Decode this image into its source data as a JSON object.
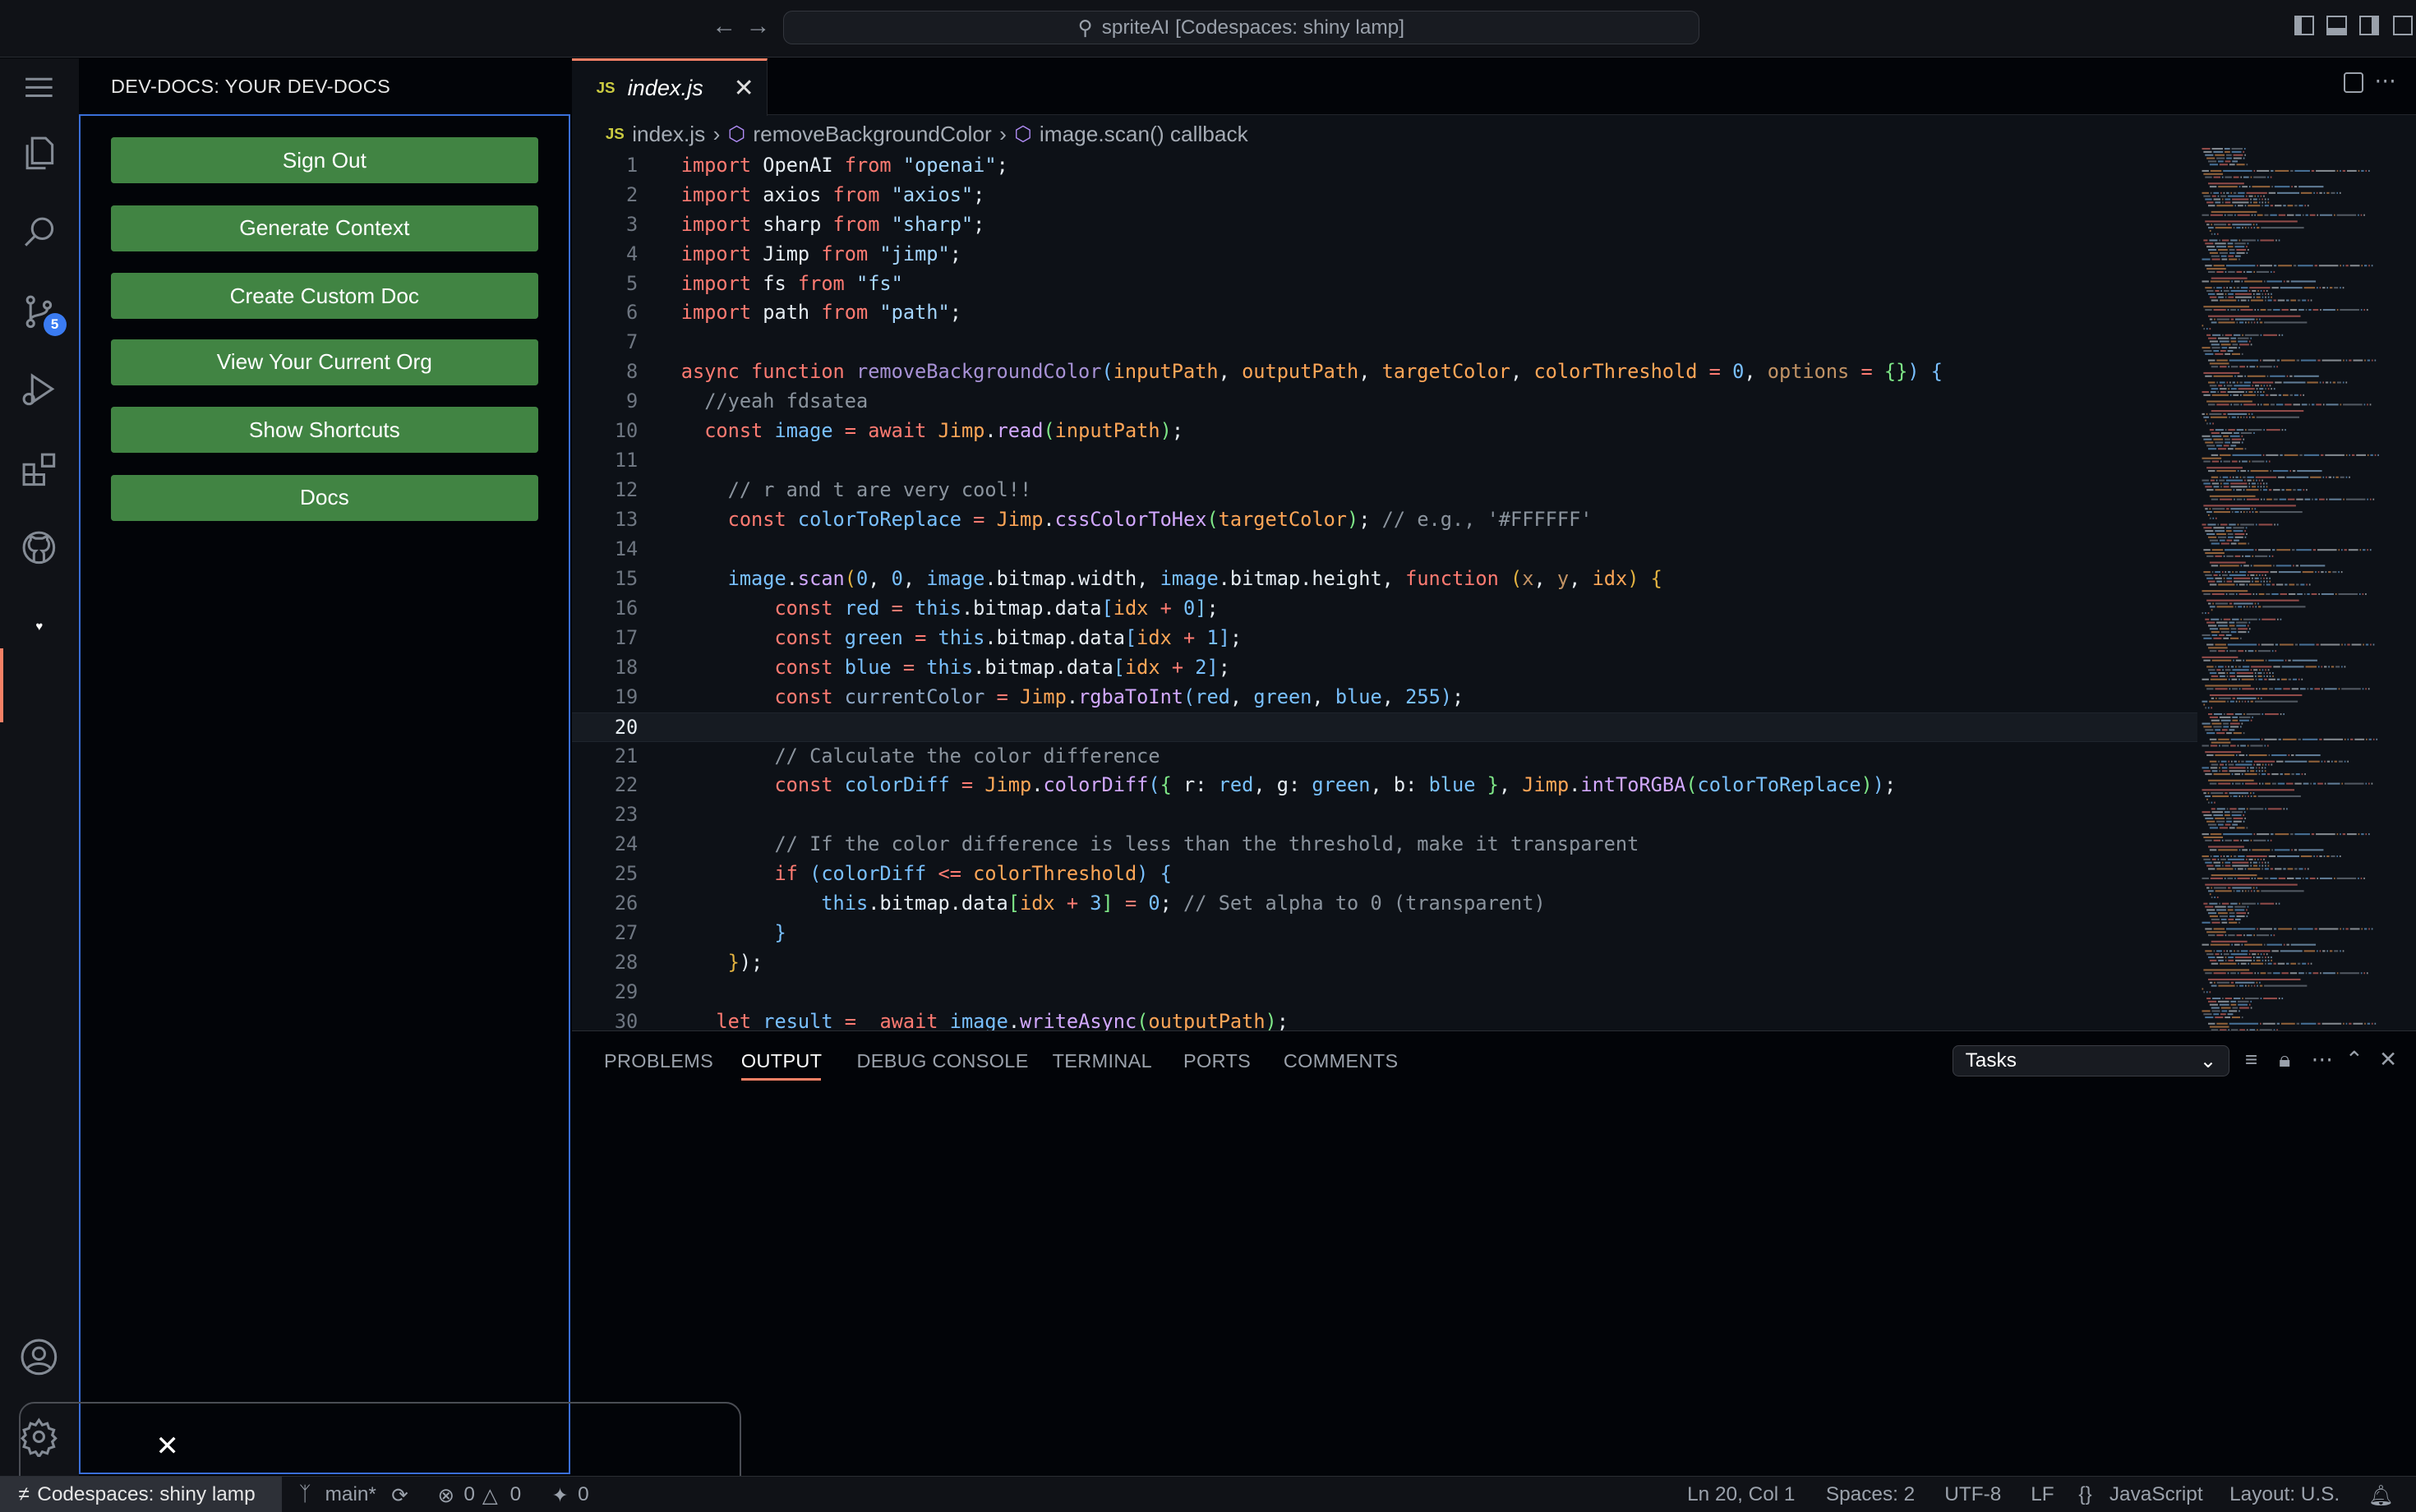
{
  "titlebar": {
    "search": "spriteAI [Codespaces: shiny lamp]"
  },
  "activity": {
    "items": [
      "menu-icon",
      "files-icon",
      "search-icon",
      "source-control-icon",
      "run-debug-icon",
      "extensions-icon",
      "github-icon",
      "dev-docs-icon"
    ],
    "source_control_badge": "5",
    "bottom": [
      "account-icon",
      "settings-gear-icon"
    ]
  },
  "sidebar": {
    "title": "DEV-DOCS: YOUR DEV-DOCS",
    "buttons": [
      "Sign Out",
      "Generate Context",
      "Create Custom Doc",
      "View Your Current Org",
      "Show Shortcuts",
      "Docs"
    ],
    "button_color": "#418443"
  },
  "editor": {
    "tab": {
      "icon": "JS",
      "label": "index.js"
    },
    "breadcrumb": [
      "index.js",
      "removeBackgroundColor",
      "image.scan() callback"
    ],
    "current_line": 20,
    "lines": [
      [
        [
          "k",
          "import"
        ],
        [
          "i",
          " OpenAI "
        ],
        [
          "k",
          "from"
        ],
        [
          "i",
          " "
        ],
        [
          "s",
          "\"openai\""
        ],
        [
          "i",
          ";"
        ]
      ],
      [
        [
          "k",
          "import"
        ],
        [
          "i",
          " axios "
        ],
        [
          "k",
          "from"
        ],
        [
          "i",
          " "
        ],
        [
          "s",
          "\"axios\""
        ],
        [
          "i",
          ";"
        ]
      ],
      [
        [
          "k",
          "import"
        ],
        [
          "i",
          " sharp "
        ],
        [
          "k",
          "from"
        ],
        [
          "i",
          " "
        ],
        [
          "s",
          "\"sharp\""
        ],
        [
          "i",
          ";"
        ]
      ],
      [
        [
          "k",
          "import"
        ],
        [
          "i",
          " Jimp "
        ],
        [
          "k",
          "from"
        ],
        [
          "i",
          " "
        ],
        [
          "s",
          "\"jimp\""
        ],
        [
          "i",
          ";"
        ]
      ],
      [
        [
          "k",
          "import"
        ],
        [
          "i",
          " fs "
        ],
        [
          "k",
          "from"
        ],
        [
          "i",
          " "
        ],
        [
          "s",
          "\"fs\""
        ]
      ],
      [
        [
          "k",
          "import"
        ],
        [
          "i",
          " path "
        ],
        [
          "k",
          "from"
        ],
        [
          "i",
          " "
        ],
        [
          "s",
          "\"path\""
        ],
        [
          "i",
          ";"
        ]
      ],
      [],
      [
        [
          "k",
          "async"
        ],
        [
          "i",
          " "
        ],
        [
          "k",
          "function"
        ],
        [
          "i",
          " "
        ],
        [
          "fm",
          "removeBackgroundColor"
        ],
        [
          "n",
          "("
        ],
        [
          "p",
          "inputPath"
        ],
        [
          "i",
          ", "
        ],
        [
          "p",
          "outputPath"
        ],
        [
          "i",
          ", "
        ],
        [
          "p",
          "targetColor"
        ],
        [
          "i",
          ", "
        ],
        [
          "p",
          "colorThreshold"
        ],
        [
          "i",
          " "
        ],
        [
          "k",
          "="
        ],
        [
          "i",
          " "
        ],
        [
          "n",
          "0"
        ],
        [
          "i",
          ", "
        ],
        [
          "pm",
          "options"
        ],
        [
          "i",
          " "
        ],
        [
          "k",
          "="
        ],
        [
          "i",
          " "
        ],
        [
          "g",
          "{}"
        ],
        [
          "n",
          ")"
        ],
        [
          "i",
          " "
        ],
        [
          "n",
          "{"
        ]
      ],
      [
        [
          "i",
          "  "
        ],
        [
          "c",
          "//yeah fdsatea"
        ]
      ],
      [
        [
          "i",
          "  "
        ],
        [
          "k",
          "const"
        ],
        [
          "i",
          " "
        ],
        [
          "n",
          "image"
        ],
        [
          "i",
          " "
        ],
        [
          "k",
          "="
        ],
        [
          "i",
          " "
        ],
        [
          "k",
          "await"
        ],
        [
          "i",
          " "
        ],
        [
          "p",
          "Jimp"
        ],
        [
          "i",
          "."
        ],
        [
          "f",
          "read"
        ],
        [
          "g",
          "("
        ],
        [
          "p",
          "inputPath"
        ],
        [
          "g",
          ")"
        ],
        [
          "i",
          ";"
        ]
      ],
      [],
      [
        [
          "i",
          "    "
        ],
        [
          "c",
          "// r and t are very cool!!"
        ]
      ],
      [
        [
          "i",
          "    "
        ],
        [
          "k",
          "const"
        ],
        [
          "i",
          " "
        ],
        [
          "n",
          "colorToReplace"
        ],
        [
          "i",
          " "
        ],
        [
          "k",
          "="
        ],
        [
          "i",
          " "
        ],
        [
          "p",
          "Jimp"
        ],
        [
          "i",
          "."
        ],
        [
          "f",
          "cssColorToHex"
        ],
        [
          "g",
          "("
        ],
        [
          "p",
          "targetColor"
        ],
        [
          "g",
          ")"
        ],
        [
          "i",
          "; "
        ],
        [
          "c",
          "// e.g., '#FFFFFF'"
        ]
      ],
      [],
      [
        [
          "i",
          "    "
        ],
        [
          "n",
          "image"
        ],
        [
          "i",
          "."
        ],
        [
          "f",
          "scan"
        ],
        [
          "y",
          "("
        ],
        [
          "n",
          "0"
        ],
        [
          "i",
          ", "
        ],
        [
          "n",
          "0"
        ],
        [
          "i",
          ", "
        ],
        [
          "n",
          "image"
        ],
        [
          "i",
          ".bitmap.width, "
        ],
        [
          "n",
          "image"
        ],
        [
          "i",
          ".bitmap.height, "
        ],
        [
          "k",
          "function"
        ],
        [
          "i",
          " "
        ],
        [
          "y",
          "("
        ],
        [
          "pm",
          "x"
        ],
        [
          "i",
          ", "
        ],
        [
          "pm",
          "y"
        ],
        [
          "i",
          ", "
        ],
        [
          "p",
          "idx"
        ],
        [
          "y",
          ")"
        ],
        [
          "i",
          " "
        ],
        [
          "y",
          "{"
        ]
      ],
      [
        [
          "i",
          "        "
        ],
        [
          "k",
          "const"
        ],
        [
          "i",
          " "
        ],
        [
          "n",
          "red"
        ],
        [
          "i",
          " "
        ],
        [
          "k",
          "="
        ],
        [
          "i",
          " "
        ],
        [
          "n",
          "this"
        ],
        [
          "i",
          ".bitmap.data"
        ],
        [
          "n",
          "["
        ],
        [
          "p",
          "idx"
        ],
        [
          "i",
          " "
        ],
        [
          "k",
          "+"
        ],
        [
          "i",
          " "
        ],
        [
          "n",
          "0"
        ],
        [
          "n",
          "]"
        ],
        [
          "i",
          ";"
        ]
      ],
      [
        [
          "i",
          "        "
        ],
        [
          "k",
          "const"
        ],
        [
          "i",
          " "
        ],
        [
          "n",
          "green"
        ],
        [
          "i",
          " "
        ],
        [
          "k",
          "="
        ],
        [
          "i",
          " "
        ],
        [
          "n",
          "this"
        ],
        [
          "i",
          ".bitmap.data"
        ],
        [
          "n",
          "["
        ],
        [
          "p",
          "idx"
        ],
        [
          "i",
          " "
        ],
        [
          "k",
          "+"
        ],
        [
          "i",
          " "
        ],
        [
          "n",
          "1"
        ],
        [
          "n",
          "]"
        ],
        [
          "i",
          ";"
        ]
      ],
      [
        [
          "i",
          "        "
        ],
        [
          "k",
          "const"
        ],
        [
          "i",
          " "
        ],
        [
          "n",
          "blue"
        ],
        [
          "i",
          " "
        ],
        [
          "k",
          "="
        ],
        [
          "i",
          " "
        ],
        [
          "n",
          "this"
        ],
        [
          "i",
          ".bitmap.data"
        ],
        [
          "n",
          "["
        ],
        [
          "p",
          "idx"
        ],
        [
          "i",
          " "
        ],
        [
          "k",
          "+"
        ],
        [
          "i",
          " "
        ],
        [
          "n",
          "2"
        ],
        [
          "n",
          "]"
        ],
        [
          "i",
          ";"
        ]
      ],
      [
        [
          "i",
          "        "
        ],
        [
          "k",
          "const"
        ],
        [
          "i",
          " "
        ],
        [
          "nm",
          "currentColor"
        ],
        [
          "i",
          " "
        ],
        [
          "k",
          "="
        ],
        [
          "i",
          " "
        ],
        [
          "p",
          "Jimp"
        ],
        [
          "i",
          "."
        ],
        [
          "f",
          "rgbaToInt"
        ],
        [
          "n",
          "("
        ],
        [
          "n",
          "red"
        ],
        [
          "i",
          ", "
        ],
        [
          "n",
          "green"
        ],
        [
          "i",
          ", "
        ],
        [
          "n",
          "blue"
        ],
        [
          "i",
          ", "
        ],
        [
          "n",
          "255"
        ],
        [
          "n",
          ")"
        ],
        [
          "i",
          ";"
        ]
      ],
      [],
      [
        [
          "i",
          "        "
        ],
        [
          "c",
          "// Calculate the color difference"
        ]
      ],
      [
        [
          "i",
          "        "
        ],
        [
          "k",
          "const"
        ],
        [
          "i",
          " "
        ],
        [
          "n",
          "colorDiff"
        ],
        [
          "i",
          " "
        ],
        [
          "k",
          "="
        ],
        [
          "i",
          " "
        ],
        [
          "p",
          "Jimp"
        ],
        [
          "i",
          "."
        ],
        [
          "f",
          "colorDiff"
        ],
        [
          "n",
          "("
        ],
        [
          "g",
          "{"
        ],
        [
          "i",
          " r: "
        ],
        [
          "n",
          "red"
        ],
        [
          "i",
          ", g: "
        ],
        [
          "n",
          "green"
        ],
        [
          "i",
          ", b: "
        ],
        [
          "n",
          "blue"
        ],
        [
          "i",
          " "
        ],
        [
          "g",
          "}"
        ],
        [
          "i",
          ", "
        ],
        [
          "p",
          "Jimp"
        ],
        [
          "i",
          "."
        ],
        [
          "f",
          "intToRGBA"
        ],
        [
          "g",
          "("
        ],
        [
          "n",
          "colorToReplace"
        ],
        [
          "g",
          ")"
        ],
        [
          "n",
          ")"
        ],
        [
          "i",
          ";"
        ]
      ],
      [],
      [
        [
          "i",
          "        "
        ],
        [
          "c",
          "// If the color difference is less than the threshold, make it transparent"
        ]
      ],
      [
        [
          "i",
          "        "
        ],
        [
          "k",
          "if"
        ],
        [
          "i",
          " "
        ],
        [
          "n",
          "("
        ],
        [
          "n",
          "colorDiff"
        ],
        [
          "i",
          " "
        ],
        [
          "k",
          "<="
        ],
        [
          "i",
          " "
        ],
        [
          "p",
          "colorThreshold"
        ],
        [
          "n",
          ")"
        ],
        [
          "i",
          " "
        ],
        [
          "n",
          "{"
        ]
      ],
      [
        [
          "i",
          "            "
        ],
        [
          "n",
          "this"
        ],
        [
          "i",
          ".bitmap.data"
        ],
        [
          "g",
          "["
        ],
        [
          "p",
          "idx"
        ],
        [
          "i",
          " "
        ],
        [
          "k",
          "+"
        ],
        [
          "i",
          " "
        ],
        [
          "n",
          "3"
        ],
        [
          "g",
          "]"
        ],
        [
          "i",
          " "
        ],
        [
          "k",
          "="
        ],
        [
          "i",
          " "
        ],
        [
          "n",
          "0"
        ],
        [
          "i",
          "; "
        ],
        [
          "c",
          "// Set alpha to 0 (transparent)"
        ]
      ],
      [
        [
          "i",
          "        "
        ],
        [
          "n",
          "}"
        ]
      ],
      [
        [
          "i",
          "    "
        ],
        [
          "y",
          "}"
        ],
        [
          "i",
          ")"
        ],
        [
          "i",
          ";"
        ]
      ],
      [],
      [
        [
          "i",
          "   "
        ],
        [
          "k",
          "let"
        ],
        [
          "i",
          " "
        ],
        [
          "n",
          "result"
        ],
        [
          "i",
          " "
        ],
        [
          "k",
          "="
        ],
        [
          "i",
          "  "
        ],
        [
          "k",
          "await"
        ],
        [
          "i",
          " "
        ],
        [
          "n",
          "image"
        ],
        [
          "i",
          "."
        ],
        [
          "f",
          "writeAsync"
        ],
        [
          "g",
          "("
        ],
        [
          "p",
          "outputPath"
        ],
        [
          "g",
          ")"
        ],
        [
          "i",
          ";"
        ]
      ]
    ]
  },
  "panel": {
    "tabs": [
      "PROBLEMS",
      "OUTPUT",
      "DEBUG CONSOLE",
      "TERMINAL",
      "PORTS",
      "COMMENTS"
    ],
    "active": "OUTPUT",
    "dropdown": "Tasks"
  },
  "statusbar": {
    "remote": "Codespaces: shiny lamp",
    "branch": "main*",
    "errors": "0",
    "warnings": "0",
    "ports": "0",
    "position": "Ln 20, Col 1",
    "spaces": "Spaces: 2",
    "encoding": "UTF-8",
    "eol": "LF",
    "language": "JavaScript",
    "layout": "Layout: U.S."
  }
}
